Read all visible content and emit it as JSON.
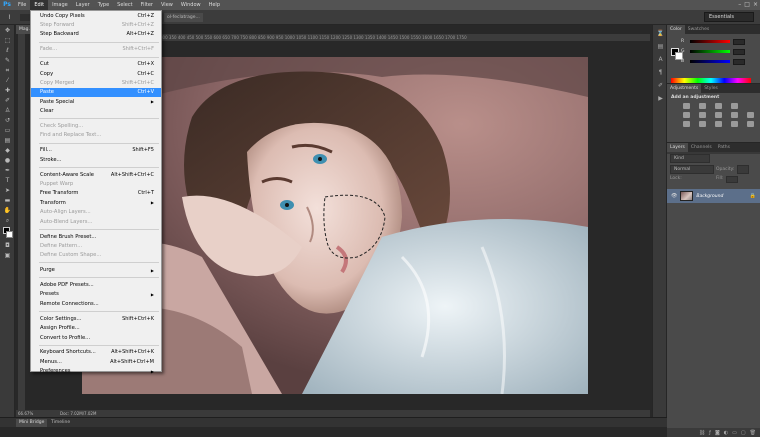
{
  "app": {
    "logo": "Ps"
  },
  "menubar": {
    "items": [
      "File",
      "Edit",
      "Image",
      "Layer",
      "Type",
      "Select",
      "Filter",
      "View",
      "Window",
      "Help"
    ],
    "active": "Edit"
  },
  "window_controls": {
    "minimize": "–",
    "maximize": "□",
    "close": "×"
  },
  "options_bar": {
    "workspace": "Essentials",
    "mini_tab": "ol-feclatrage..."
  },
  "document": {
    "tab_label": "Mag...",
    "zoom": "66.67%",
    "doc_info": "Doc: 7.02M/7.02M",
    "ruler_marks": "300  350  400  450  500  550  600  650  700  750  800  850  900  950  1000  1050  1100  1150  1200  1250  1300  1350  1400  1450  1500  1550  1600  1650  1700  1750"
  },
  "edit_menu": {
    "groups": [
      [
        {
          "label": "Undo Copy Pixels",
          "shortcut": "Ctrl+Z",
          "disabled": false
        },
        {
          "label": "Step Forward",
          "shortcut": "Shift+Ctrl+Z",
          "disabled": true
        },
        {
          "label": "Step Backward",
          "shortcut": "Alt+Ctrl+Z",
          "disabled": false
        }
      ],
      [
        {
          "label": "Fade...",
          "shortcut": "Shift+Ctrl+F",
          "disabled": true
        }
      ],
      [
        {
          "label": "Cut",
          "shortcut": "Ctrl+X",
          "disabled": false
        },
        {
          "label": "Copy",
          "shortcut": "Ctrl+C",
          "disabled": false
        },
        {
          "label": "Copy Merged",
          "shortcut": "Shift+Ctrl+C",
          "disabled": true
        },
        {
          "label": "Paste",
          "shortcut": "Ctrl+V",
          "disabled": false,
          "highlight": true
        },
        {
          "label": "Paste Special",
          "shortcut": "",
          "disabled": false,
          "submenu": true
        },
        {
          "label": "Clear",
          "shortcut": "",
          "disabled": false
        }
      ],
      [
        {
          "label": "Check Spelling...",
          "shortcut": "",
          "disabled": true
        },
        {
          "label": "Find and Replace Text...",
          "shortcut": "",
          "disabled": true
        }
      ],
      [
        {
          "label": "Fill...",
          "shortcut": "Shift+F5",
          "disabled": false
        },
        {
          "label": "Stroke...",
          "shortcut": "",
          "disabled": false
        }
      ],
      [
        {
          "label": "Content-Aware Scale",
          "shortcut": "Alt+Shift+Ctrl+C",
          "disabled": false
        },
        {
          "label": "Puppet Warp",
          "shortcut": "",
          "disabled": true
        },
        {
          "label": "Free Transform",
          "shortcut": "Ctrl+T",
          "disabled": false
        },
        {
          "label": "Transform",
          "shortcut": "",
          "disabled": false,
          "submenu": true
        },
        {
          "label": "Auto-Align Layers...",
          "shortcut": "",
          "disabled": true
        },
        {
          "label": "Auto-Blend Layers...",
          "shortcut": "",
          "disabled": true
        }
      ],
      [
        {
          "label": "Define Brush Preset...",
          "shortcut": "",
          "disabled": false
        },
        {
          "label": "Define Pattern...",
          "shortcut": "",
          "disabled": true
        },
        {
          "label": "Define Custom Shape...",
          "shortcut": "",
          "disabled": true
        }
      ],
      [
        {
          "label": "Purge",
          "shortcut": "",
          "disabled": false,
          "submenu": true
        }
      ],
      [
        {
          "label": "Adobe PDF Presets...",
          "shortcut": "",
          "disabled": false
        },
        {
          "label": "Presets",
          "shortcut": "",
          "disabled": false,
          "submenu": true
        },
        {
          "label": "Remote Connections...",
          "shortcut": "",
          "disabled": false
        }
      ],
      [
        {
          "label": "Color Settings...",
          "shortcut": "Shift+Ctrl+K",
          "disabled": false
        },
        {
          "label": "Assign Profile...",
          "shortcut": "",
          "disabled": false
        },
        {
          "label": "Convert to Profile...",
          "shortcut": "",
          "disabled": false
        }
      ],
      [
        {
          "label": "Keyboard Shortcuts...",
          "shortcut": "Alt+Shift+Ctrl+K",
          "disabled": false
        },
        {
          "label": "Menus...",
          "shortcut": "Alt+Shift+Ctrl+M",
          "disabled": false
        },
        {
          "label": "Preferences",
          "shortcut": "",
          "disabled": false,
          "submenu": true
        }
      ]
    ]
  },
  "color_panel": {
    "tabs": [
      "Color",
      "Swatches"
    ],
    "channels": [
      "R",
      "G",
      "B"
    ],
    "colors": {
      "fg": "#000000",
      "bg": "#ffffff"
    }
  },
  "adjustments_panel": {
    "tabs": [
      "Adjustments",
      "Styles"
    ],
    "title": "Add an adjustment"
  },
  "layers_panel": {
    "tabs": [
      "Layers",
      "Channels",
      "Paths"
    ],
    "kind_filter": "Kind",
    "blend_mode": "Normal",
    "opacity_label": "Opacity:",
    "lock_label": "Lock:",
    "fill_label": "Fill:",
    "layer_name": "Background"
  },
  "bottom_tabs": [
    "Mini Bridge",
    "Timeline"
  ]
}
